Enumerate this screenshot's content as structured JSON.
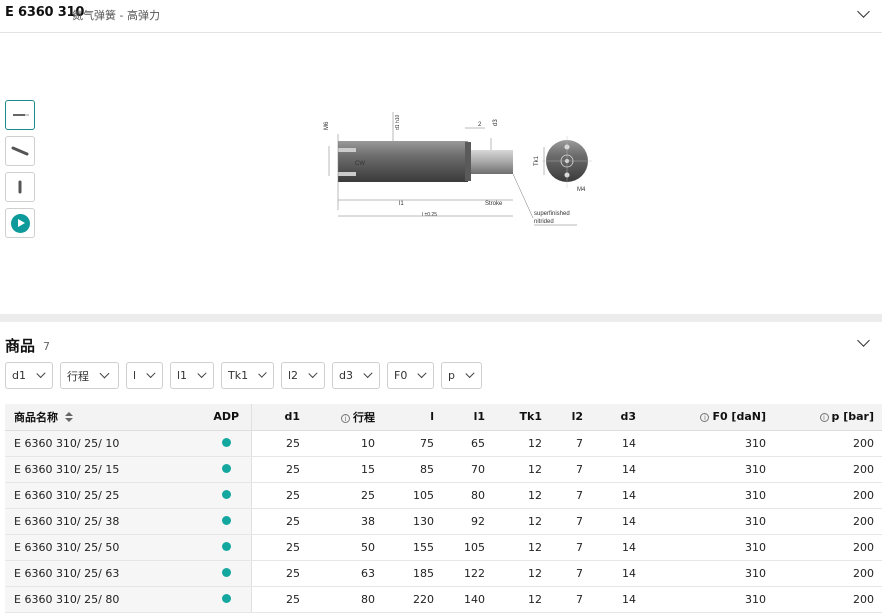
{
  "header": {
    "code": "E 6360 310",
    "description": "氮气弹簧 - 高弹力"
  },
  "drawing": {
    "labels": {
      "m6": "M6",
      "d1": "d1 h10",
      "d3": "d3",
      "two": "2",
      "tk1": "Tk1",
      "m4": "M4",
      "cw": "CW",
      "l1": "l1",
      "l": "l ±0.25",
      "stroke": "Stroke",
      "note1": "superfinished",
      "note2": "nitrided"
    }
  },
  "products": {
    "title": "商品",
    "count": "7"
  },
  "filters": [
    "d1",
    "行程",
    "l",
    "l1",
    "Tk1",
    "l2",
    "d3",
    "F0",
    "p"
  ],
  "table": {
    "headers": {
      "name": "商品名称",
      "adp": "ADP",
      "d1": "d1",
      "stroke": "行程",
      "l": "l",
      "l1": "l1",
      "tk1": "Tk1",
      "l2": "l2",
      "d3": "d3",
      "f0": "F0 [daN]",
      "p": "p [bar]"
    },
    "rows": [
      {
        "name": "E 6360 310/ 25/ 10",
        "d1": "25",
        "stroke": "10",
        "l": "75",
        "l1": "65",
        "tk1": "12",
        "l2": "7",
        "d3": "14",
        "f0": "310",
        "p": "200"
      },
      {
        "name": "E 6360 310/ 25/ 15",
        "d1": "25",
        "stroke": "15",
        "l": "85",
        "l1": "70",
        "tk1": "12",
        "l2": "7",
        "d3": "14",
        "f0": "310",
        "p": "200"
      },
      {
        "name": "E 6360 310/ 25/ 25",
        "d1": "25",
        "stroke": "25",
        "l": "105",
        "l1": "80",
        "tk1": "12",
        "l2": "7",
        "d3": "14",
        "f0": "310",
        "p": "200"
      },
      {
        "name": "E 6360 310/ 25/ 38",
        "d1": "25",
        "stroke": "38",
        "l": "130",
        "l1": "92",
        "tk1": "12",
        "l2": "7",
        "d3": "14",
        "f0": "310",
        "p": "200"
      },
      {
        "name": "E 6360 310/ 25/ 50",
        "d1": "25",
        "stroke": "50",
        "l": "155",
        "l1": "105",
        "tk1": "12",
        "l2": "7",
        "d3": "14",
        "f0": "310",
        "p": "200"
      },
      {
        "name": "E 6360 310/ 25/ 63",
        "d1": "25",
        "stroke": "63",
        "l": "185",
        "l1": "122",
        "tk1": "12",
        "l2": "7",
        "d3": "14",
        "f0": "310",
        "p": "200"
      },
      {
        "name": "E 6360 310/ 25/ 80",
        "d1": "25",
        "stroke": "80",
        "l": "220",
        "l1": "140",
        "tk1": "12",
        "l2": "7",
        "d3": "14",
        "f0": "310",
        "p": "200"
      }
    ]
  }
}
